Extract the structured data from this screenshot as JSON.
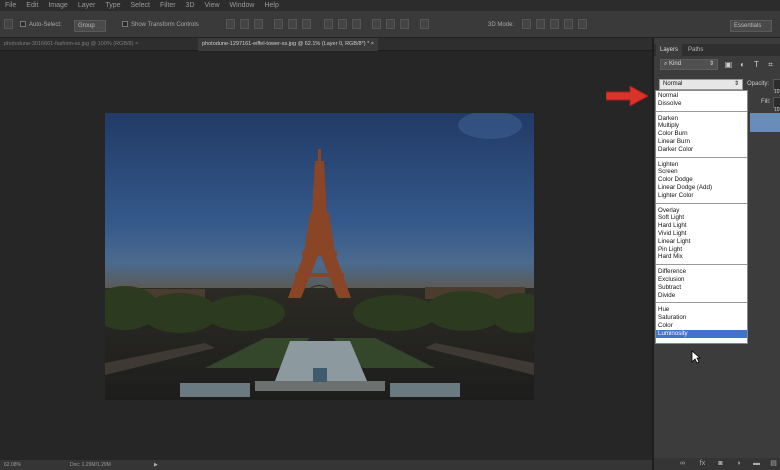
{
  "menu": [
    "File",
    "Edit",
    "Image",
    "Layer",
    "Type",
    "Select",
    "Filter",
    "3D",
    "View",
    "Window",
    "Help"
  ],
  "options": {
    "auto_select_label": "Auto-Select:",
    "auto_select_value": "Group",
    "transform_label": "Show Transform Controls",
    "mode_3d": "3D Mode:",
    "workspace": "Essentials"
  },
  "tabs": [
    {
      "label": "photodune-3016661-fashion-xs.jpg @ 100% (RGB/8)",
      "active": false
    },
    {
      "label": "photodune-1297161-eiffel-tower-xs.jpg @ 62.1% (Layer 0, RGB/8*) *",
      "active": true
    }
  ],
  "status": {
    "zoom": "62.08%",
    "doc": "Doc: 1.29M/1.29M"
  },
  "panel": {
    "tabs": [
      {
        "label": "Layers",
        "active": true
      },
      {
        "label": "Paths",
        "active": false
      }
    ],
    "kind_label": "Kind",
    "blend_mode": "Normal",
    "opacity_label": "Opacity:",
    "opacity_value": "10",
    "fill_label": "Fill:",
    "fill_value": "10"
  },
  "blend_modes": {
    "groups": [
      [
        "Normal",
        "Dissolve"
      ],
      [
        "Darken",
        "Multiply",
        "Color Burn",
        "Linear Burn",
        "Darker Color"
      ],
      [
        "Lighten",
        "Screen",
        "Color Dodge",
        "Linear Dodge (Add)",
        "Lighter Color"
      ],
      [
        "Overlay",
        "Soft Light",
        "Hard Light",
        "Vivid Light",
        "Linear Light",
        "Pin Light",
        "Hard Mix"
      ],
      [
        "Difference",
        "Exclusion",
        "Subtract",
        "Divide"
      ],
      [
        "Hue",
        "Saturation",
        "Color",
        "Luminosity"
      ]
    ],
    "selected": "Luminosity"
  },
  "icons": {
    "kind": "search-icon",
    "image_filter": "image-filter-icon",
    "adjust_filter": "adjustment-filter-icon",
    "type_filter": "type-filter-icon",
    "shape_filter": "shape-filter-icon",
    "bottom": [
      "link-icon",
      "fx-icon",
      "mask-icon",
      "adjustment-icon",
      "folder-icon",
      "new-layer-icon"
    ]
  },
  "colors": {
    "accent": "#3e74c9",
    "arrow": "#d9342b",
    "panel_bg": "#3c3c3c"
  }
}
